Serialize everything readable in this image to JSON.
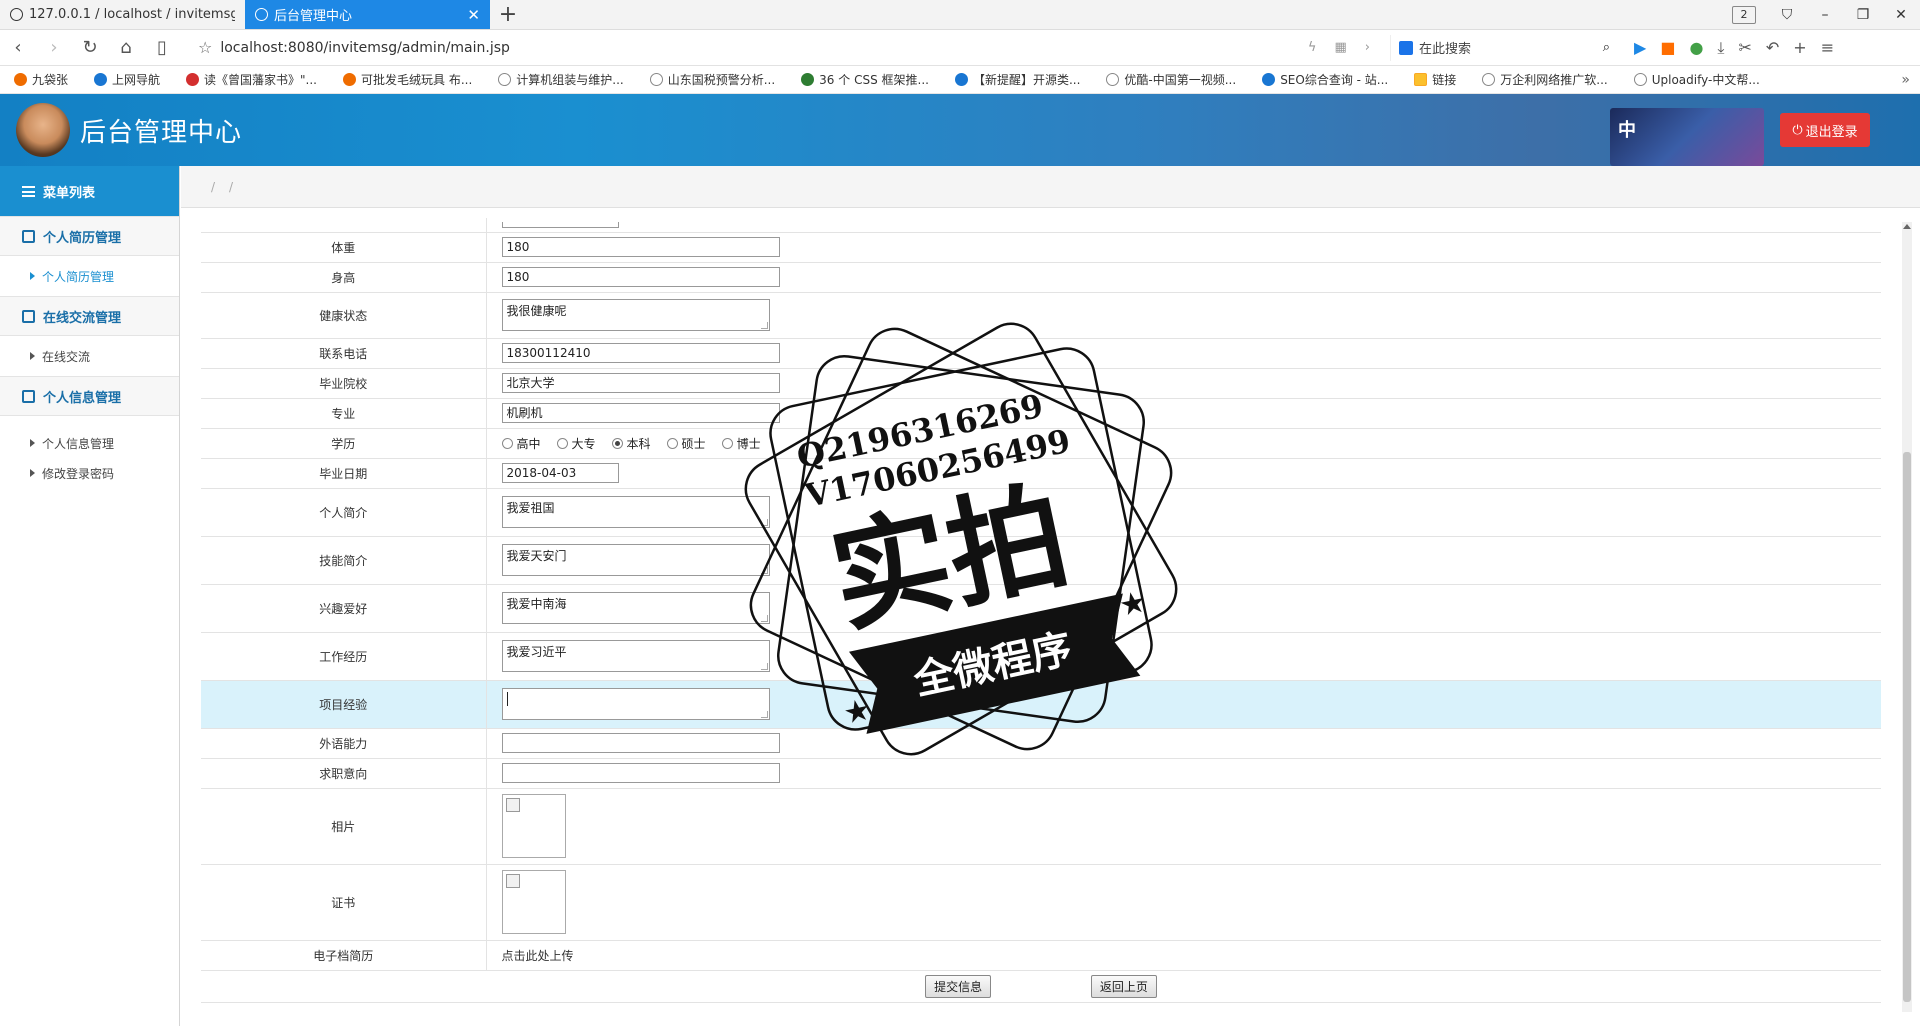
{
  "browser": {
    "tabs": [
      {
        "label": "127.0.0.1 / localhost / invitemsg / ‹",
        "active": false
      },
      {
        "label": "后台管理中心",
        "active": true
      }
    ],
    "tab_count": "2",
    "url": "localhost:8080/invitemsg/admin/main.jsp",
    "search_placeholder": "在此搜索",
    "bookmarks": [
      {
        "label": "九袋张",
        "icon": "person-icon"
      },
      {
        "label": "上网导航",
        "icon": "ie-icon"
      },
      {
        "label": "读《曾国藩家书》\"...",
        "icon": "red-icon"
      },
      {
        "label": "可批发毛绒玩具 布...",
        "icon": "orange-icon"
      },
      {
        "label": "计算机组装与维护...",
        "icon": "globe-icon"
      },
      {
        "label": "山东国税预警分析...",
        "icon": "globe-icon"
      },
      {
        "label": "36 个 CSS 框架推...",
        "icon": "green-icon"
      },
      {
        "label": "【新提醒】开源类...",
        "icon": "blue-icon"
      },
      {
        "label": "优酷-中国第一视频...",
        "icon": "globe-icon"
      },
      {
        "label": "SEO综合查询 - 站...",
        "icon": "seo-icon"
      },
      {
        "label": "链接",
        "icon": "folder-icon"
      },
      {
        "label": "万企利网络推广软...",
        "icon": "globe-icon"
      },
      {
        "label": "Uploadify-中文帮...",
        "icon": "globe-icon"
      }
    ]
  },
  "header": {
    "title": "后台管理中心",
    "banner_text": "中",
    "logout_label": "退出登录"
  },
  "sidebar": {
    "title": "菜单列表",
    "groups": [
      {
        "label": "个人简历管理",
        "items": [
          {
            "label": "个人简历管理",
            "active": true
          }
        ]
      },
      {
        "label": "在线交流管理",
        "items": [
          {
            "label": "在线交流",
            "active": false
          }
        ]
      },
      {
        "label": "个人信息管理",
        "items": [
          {
            "label": "个人信息管理",
            "active": false
          },
          {
            "label": "修改登录密码",
            "active": false
          }
        ]
      }
    ]
  },
  "breadcrumb": [
    "/",
    "/"
  ],
  "form": {
    "weight_label": "体重",
    "weight": "180",
    "height_label": "身高",
    "height": "180",
    "health_label": "健康状态",
    "health": "我很健康呢",
    "phone_label": "联系电话",
    "phone": "18300112410",
    "school_label": "毕业院校",
    "school": "北京大学",
    "major_label": "专业",
    "major": "机刷机",
    "edu_label": "学历",
    "edu_options": [
      "高中",
      "大专",
      "本科",
      "硕士",
      "博士"
    ],
    "edu_selected": "本科",
    "grad_date_label": "毕业日期",
    "grad_date": "2018-04-03",
    "intro_label": "个人简介",
    "intro": "我爱祖国",
    "skills_label": "技能简介",
    "skills": "我爱天安门",
    "hobby_label": "兴趣爱好",
    "hobby": "我爱中南海",
    "work_label": "工作经历",
    "work": "我爱习近平",
    "project_label": "项目经验",
    "project": "",
    "language_label": "外语能力",
    "language": "",
    "intent_label": "求职意向",
    "intent": "",
    "photo_label": "相片",
    "cert_label": "证书",
    "ecv_label": "电子档简历",
    "ecv_link": "点击此处上传",
    "submit_label": "提交信息",
    "back_label": "返回上页"
  },
  "watermark": {
    "line1": "Q2196316269",
    "line2": "V17060256499",
    "main": "实拍",
    "ribbon": "全微程序"
  },
  "colors": {
    "accent": "#1a8fd0",
    "logout": "#e53935",
    "highlight_row": "#d9f2fb"
  }
}
